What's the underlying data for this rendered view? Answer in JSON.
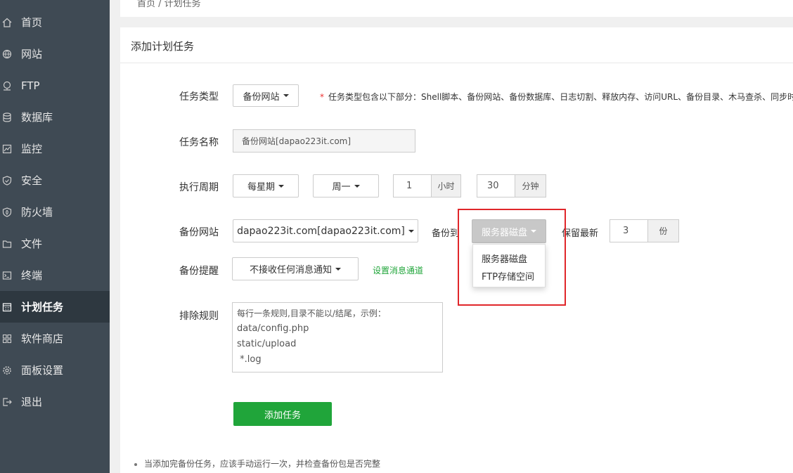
{
  "breadcrumb": {
    "text": "首页 / 计划任务"
  },
  "sidebar": {
    "items": [
      {
        "label": "首页",
        "icon": "home-icon"
      },
      {
        "label": "网站",
        "icon": "globe-icon"
      },
      {
        "label": "FTP",
        "icon": "ftp-icon"
      },
      {
        "label": "数据库",
        "icon": "database-icon"
      },
      {
        "label": "监控",
        "icon": "monitor-icon"
      },
      {
        "label": "安全",
        "icon": "shield-icon"
      },
      {
        "label": "防火墙",
        "icon": "firewall-icon"
      },
      {
        "label": "文件",
        "icon": "folder-icon"
      },
      {
        "label": "终端",
        "icon": "terminal-icon"
      },
      {
        "label": "计划任务",
        "icon": "calendar-icon",
        "active": true
      },
      {
        "label": "软件商店",
        "icon": "apps-icon"
      },
      {
        "label": "面板设置",
        "icon": "gear-icon"
      },
      {
        "label": "退出",
        "icon": "logout-icon"
      }
    ]
  },
  "panel": {
    "title": "添加计划任务",
    "task_type": {
      "label": "任务类型",
      "value": "备份网站",
      "hint_star": "*",
      "hint": "任务类型包含以下部分：Shell脚本、备份网站、备份数据库、日志切割、释放内存、访问URL、备份目录、木马查杀、同步时"
    },
    "task_name": {
      "label": "任务名称",
      "value": "备份网站[dapao223it.com]"
    },
    "cycle": {
      "label": "执行周期",
      "period": "每星期",
      "weekday": "周一",
      "hour": "1",
      "hour_unit": "小时",
      "minute": "30",
      "minute_unit": "分钟"
    },
    "backup_site": {
      "label": "备份网站",
      "value": "dapao223it.com[dapao223it.com]",
      "backup_to_label": "备份到",
      "backup_to_value": "服务器磁盘",
      "keep_label": "保留最新",
      "keep_value": "3",
      "keep_unit": "份"
    },
    "dropdown_options": [
      "服务器磁盘",
      "FTP存储空间"
    ],
    "notify": {
      "label": "备份提醒",
      "value": "不接收任何消息通知",
      "link": "设置消息通道"
    },
    "exclude": {
      "label": "排除规则",
      "lines": [
        "每行一条规则,目录不能以/结尾，示例：",
        "data/config.php",
        "static/upload",
        " *.log"
      ]
    },
    "submit_label": "添加任务",
    "note": "当添加完备份任务，应该手动运行一次，并检查备份包是否完整"
  },
  "colors": {
    "sidebar": "#3f4a54",
    "accent_green": "#20a53a",
    "highlight_red": "#e0262a"
  }
}
